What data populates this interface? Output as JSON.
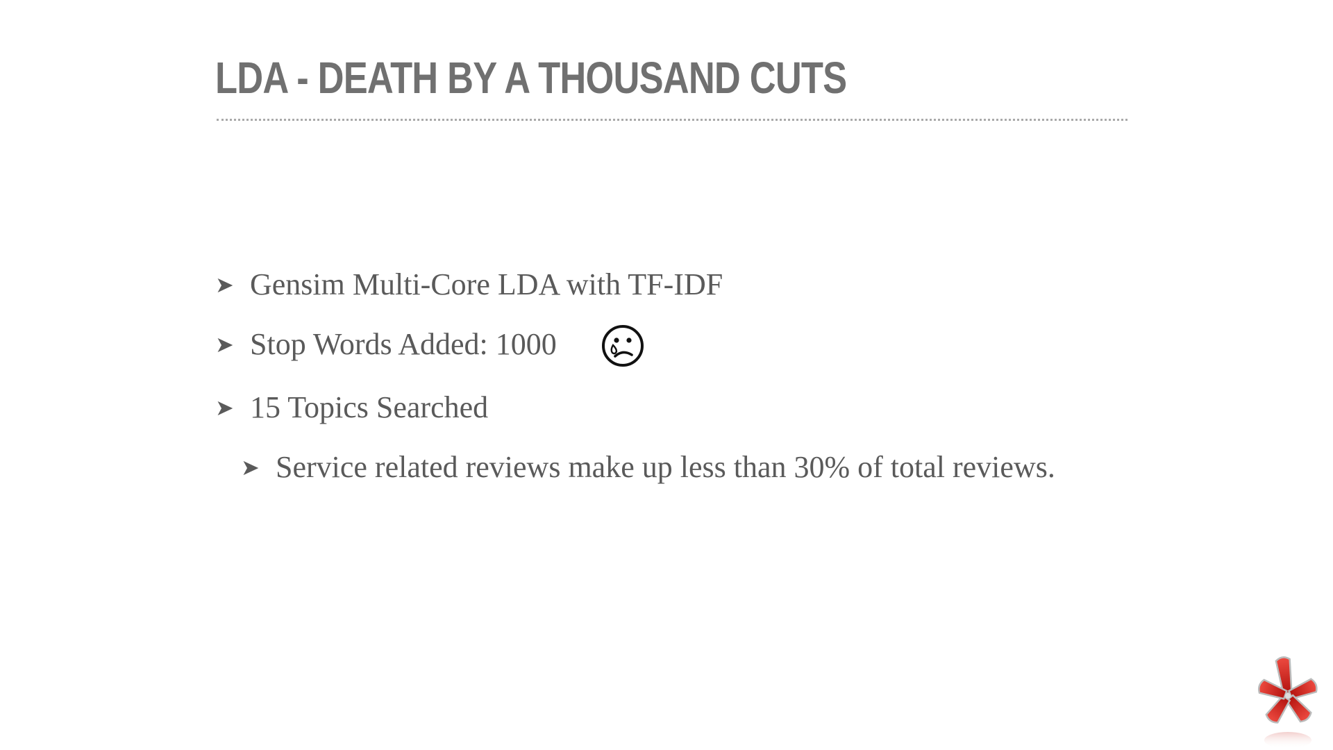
{
  "slide": {
    "title": "LDA - DEATH BY A THOUSAND CUTS",
    "bullets": [
      {
        "text": "Gensim Multi-Core LDA with TF-IDF",
        "level": 1
      },
      {
        "text": "Stop Words Added:  1000",
        "level": 1,
        "icon": "sad-face-icon"
      },
      {
        "text": "15 Topics Searched",
        "level": 1
      },
      {
        "text": "Service related reviews make up less than 30% of total reviews.",
        "level": 2
      }
    ],
    "logo_icon": "yelp-burst-logo",
    "colors": {
      "title": "#707070",
      "body": "#5a5a5a",
      "rule": "#a9a9a9",
      "logo_red": "#d0211c"
    }
  }
}
